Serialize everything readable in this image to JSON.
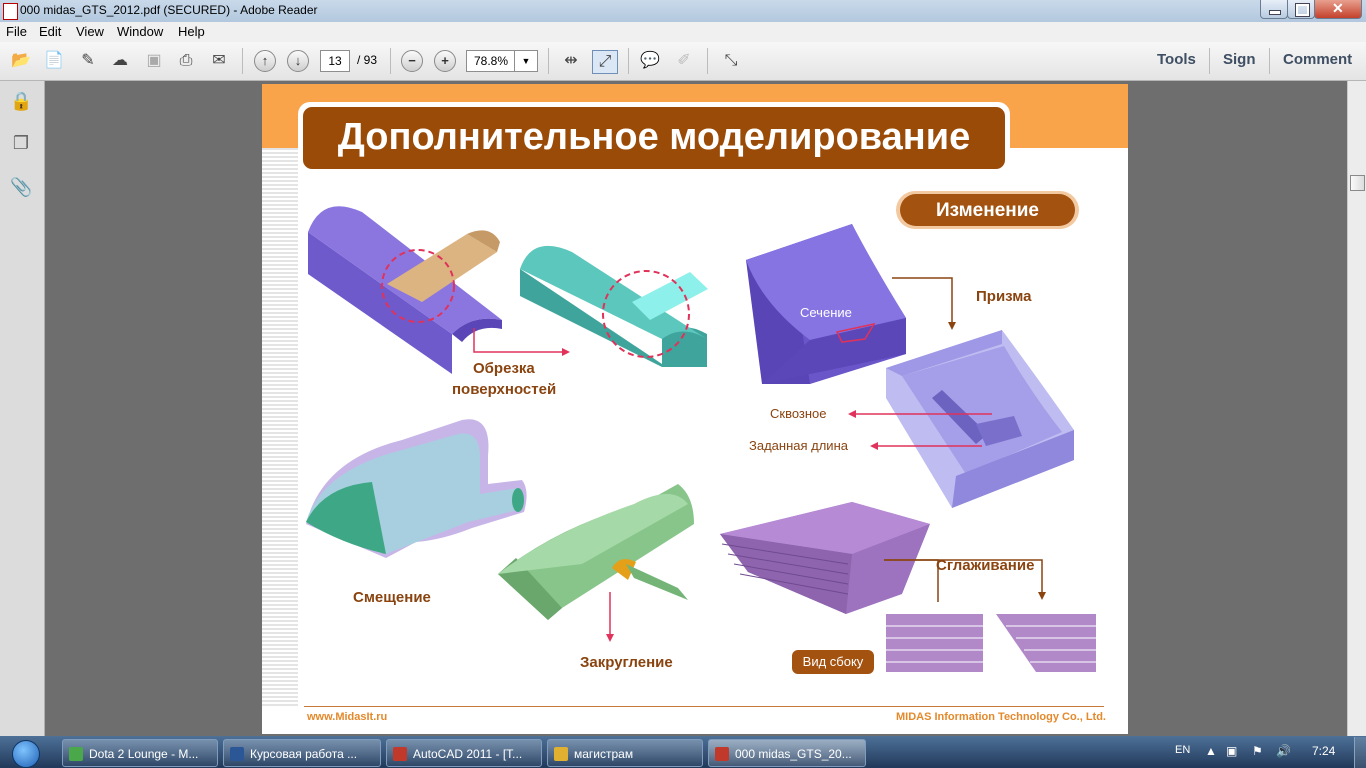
{
  "window": {
    "title": "000 midas_GTS_2012.pdf (SECURED) - Adobe Reader",
    "buttons": {
      "minimize": "minimize-icon",
      "maximize": "maximize-icon",
      "close": "close-icon"
    }
  },
  "menu": {
    "items": [
      "File",
      "Edit",
      "View",
      "Window",
      "Help"
    ]
  },
  "toolbar": {
    "page_current": "13",
    "page_total": "/ 93",
    "zoom": "78.8%",
    "links": [
      "Tools",
      "Sign",
      "Comment"
    ]
  },
  "left_pane": {
    "icons": [
      "lock-icon",
      "pages-icon",
      "attachment-icon"
    ]
  },
  "slide": {
    "title": "Дополнительное моделирование",
    "badge": "Изменение",
    "labels": {
      "trim": "Обрезка",
      "trim2": "поверхностей",
      "section": "Сечение",
      "prism": "Призма",
      "through": "Сквозное",
      "given_length": "Заданная длина",
      "offset": "Смещение",
      "fillet": "Закругление",
      "smoothing": "Сглаживание",
      "side_view": "Вид сбоку"
    },
    "footer_left": "www.MidasIt.ru",
    "footer_right": "MIDAS Information Technology Co., Ltd."
  },
  "taskbar": {
    "tasks": [
      {
        "label": "Dota 2 Lounge - M...",
        "color": "#4aa84a"
      },
      {
        "label": "Курсовая работа ...",
        "color": "#2b5797"
      },
      {
        "label": "AutoCAD 2011 - [Т...",
        "color": "#c0392b"
      },
      {
        "label": "магистрам",
        "color": "#e0b030"
      },
      {
        "label": "000 midas_GTS_20...",
        "color": "#c0392b"
      }
    ],
    "lang": "EN",
    "time": "7:24"
  },
  "colors": {
    "accent_orange": "#f9a34a",
    "title_brown": "#9a4b08",
    "label_brown": "#8a4410",
    "purple": "#8a76d8"
  }
}
